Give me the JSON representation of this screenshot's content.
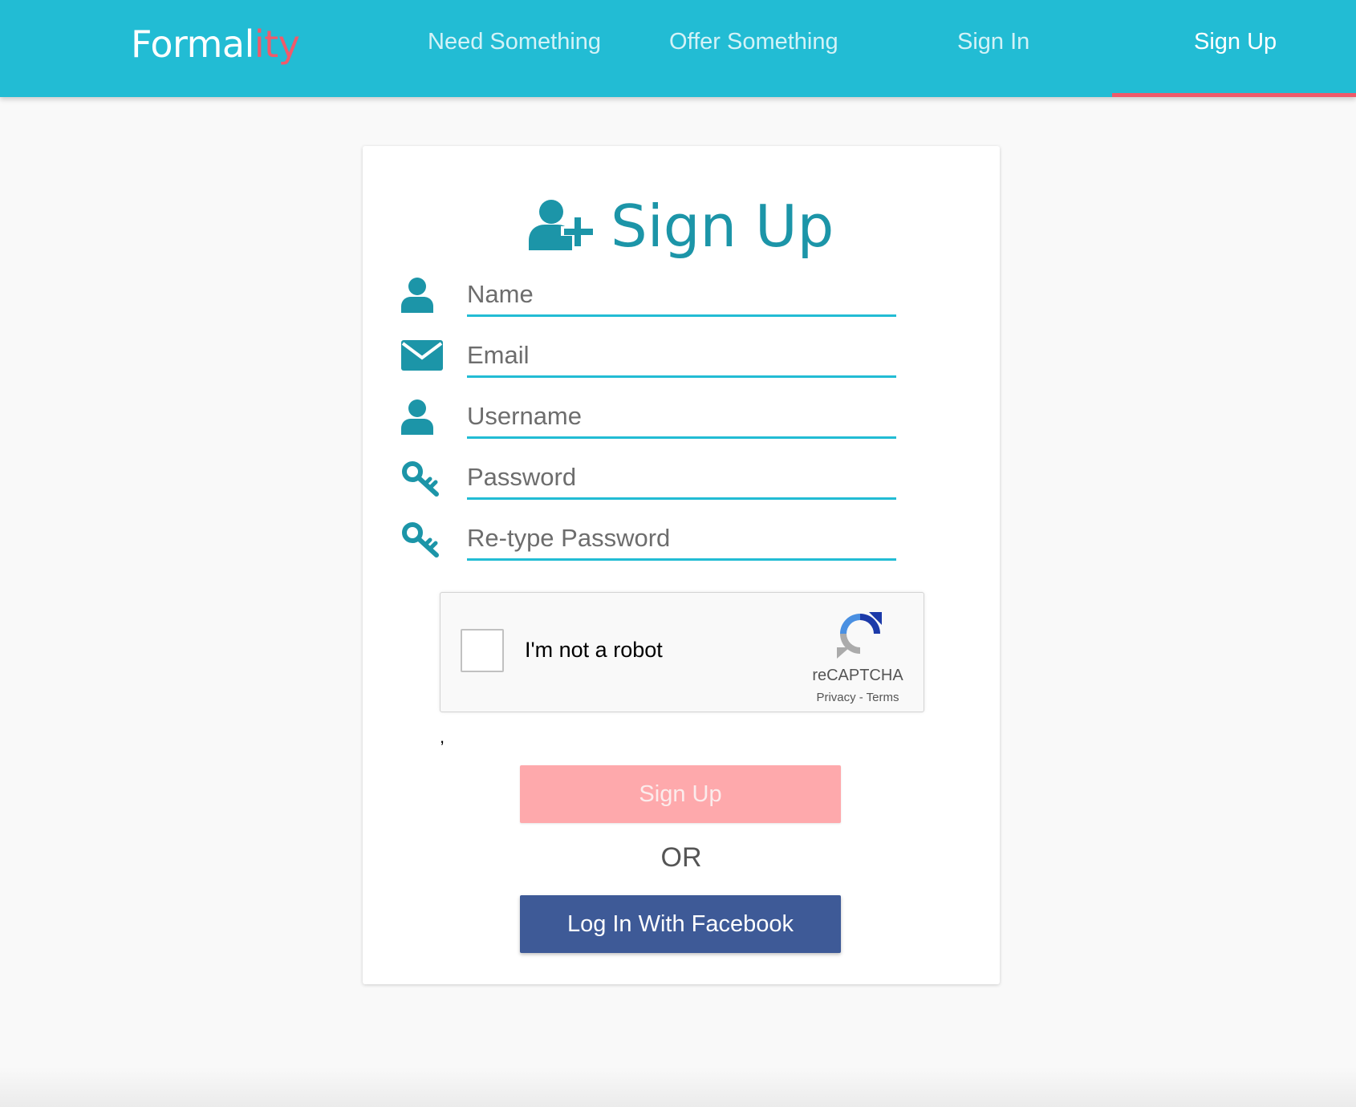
{
  "brand": {
    "name_main": "Formal",
    "name_accent": "ity"
  },
  "nav": {
    "items": [
      {
        "label": "Need Something"
      },
      {
        "label": "Offer Something"
      },
      {
        "label": "Sign In"
      },
      {
        "label": "Sign Up",
        "active": true
      }
    ]
  },
  "form": {
    "title": "Sign Up",
    "title_icon": "user-plus-icon",
    "fields": [
      {
        "placeholder": "Name",
        "icon": "user-icon",
        "value": ""
      },
      {
        "placeholder": "Email",
        "icon": "envelope-icon",
        "value": ""
      },
      {
        "placeholder": "Username",
        "icon": "user-icon",
        "value": ""
      },
      {
        "placeholder": "Password",
        "icon": "key-icon",
        "value": ""
      },
      {
        "placeholder": "Re-type Password",
        "icon": "key-icon",
        "value": ""
      }
    ],
    "captcha": {
      "label": "I'm not a robot",
      "brand": "reCAPTCHA",
      "links": "Privacy - Terms",
      "checked": false
    },
    "stray_text": ",",
    "submit_label": "Sign Up",
    "or_text": "OR",
    "facebook_label": "Log In With Facebook"
  },
  "colors": {
    "primary": "#22bcd4",
    "primary_dark": "#1c95a8",
    "accent": "#f05a6a",
    "signup_button": "#fea9ac",
    "facebook_button": "#3e5a97",
    "background": "#f9f9f9"
  }
}
